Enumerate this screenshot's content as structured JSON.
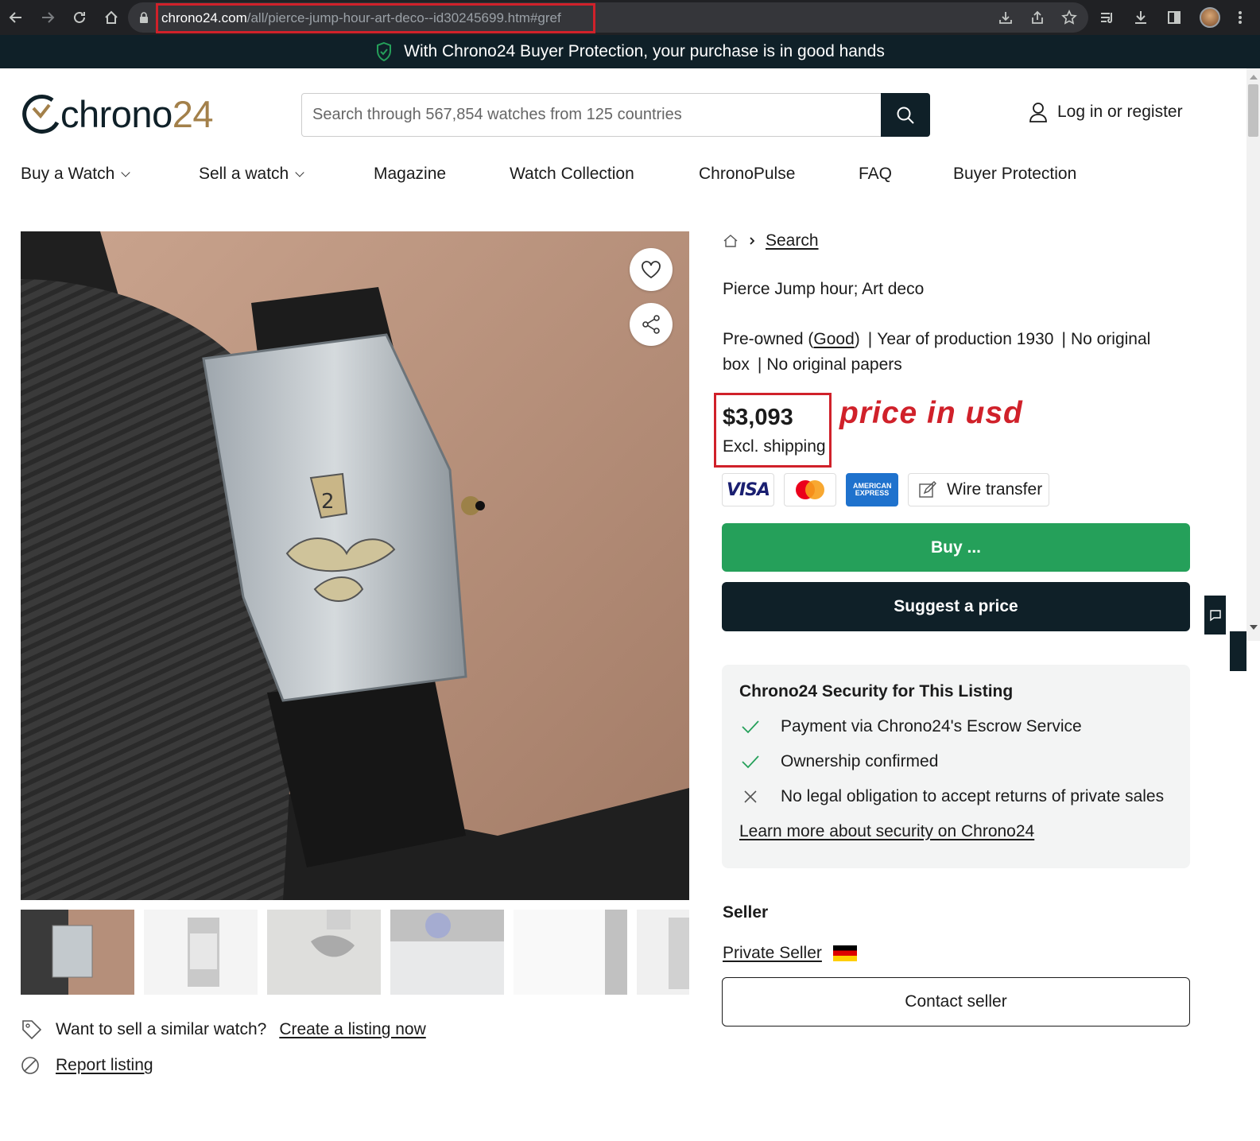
{
  "browser": {
    "url_host": "chrono24.com",
    "url_path": "/all/pierce-jump-hour-art-deco--id30245699.htm#gref",
    "toolbar_icons": [
      "back-icon",
      "forward-icon",
      "reload-icon",
      "home-icon",
      "lock-icon",
      "install-icon",
      "share-icon",
      "star-icon",
      "media-icon",
      "download-icon",
      "sidepanel-icon",
      "profile-avatar",
      "menu-icon"
    ]
  },
  "banner": {
    "text": "With Chrono24 Buyer Protection, your purchase is in good hands",
    "icon": "shield-check-icon"
  },
  "header": {
    "logo_text": "chrono",
    "logo_num": "24",
    "search_placeholder": "Search through 567,854 watches from 125 countries",
    "login_label": "Log in or register"
  },
  "nav": {
    "items": [
      {
        "label": "Buy a Watch",
        "dropdown": true
      },
      {
        "label": "Sell a watch",
        "dropdown": true
      },
      {
        "label": "Magazine"
      },
      {
        "label": "Watch Collection"
      },
      {
        "label": "ChronoPulse"
      },
      {
        "label": "FAQ"
      },
      {
        "label": "Buyer Protection"
      }
    ]
  },
  "gallery": {
    "thumbnail_count": 6
  },
  "sell_prompt": {
    "text": "Want to sell a similar watch?",
    "link": "Create a listing now"
  },
  "report": {
    "link": "Report listing"
  },
  "breadcrumb": {
    "link": "Search"
  },
  "listing": {
    "title": "Pierce Jump hour; Art deco",
    "condition_prefix": "Pre-owned (",
    "condition": "Good",
    "condition_suffix": ")",
    "year": "Year of production 1930",
    "box": "No original box",
    "papers": "No original papers",
    "price": "$3,093",
    "shipping": "Excl. shipping",
    "annotation": "price in usd"
  },
  "payment": {
    "visa": "VISA",
    "amex": "AMERICAN EXPRESS",
    "wire": "Wire transfer"
  },
  "actions": {
    "buy": "Buy ...",
    "suggest": "Suggest a price",
    "contact": "Contact seller"
  },
  "security": {
    "title": "Chrono24 Security for This Listing",
    "items": [
      {
        "text": "Payment via Chrono24's Escrow Service",
        "status": "check"
      },
      {
        "text": "Ownership confirmed",
        "status": "check"
      },
      {
        "text": "No legal obligation to accept returns of private sales",
        "status": "cross"
      }
    ],
    "link": "Learn more about security on Chrono24"
  },
  "seller": {
    "heading": "Seller",
    "name": "Private Seller",
    "country_flag": "germany-flag"
  },
  "colors": {
    "brand_dark": "#0f2028",
    "brand_gold": "#a3804a",
    "buy_green": "#25a05a",
    "annotation_red": "#d0212a"
  }
}
